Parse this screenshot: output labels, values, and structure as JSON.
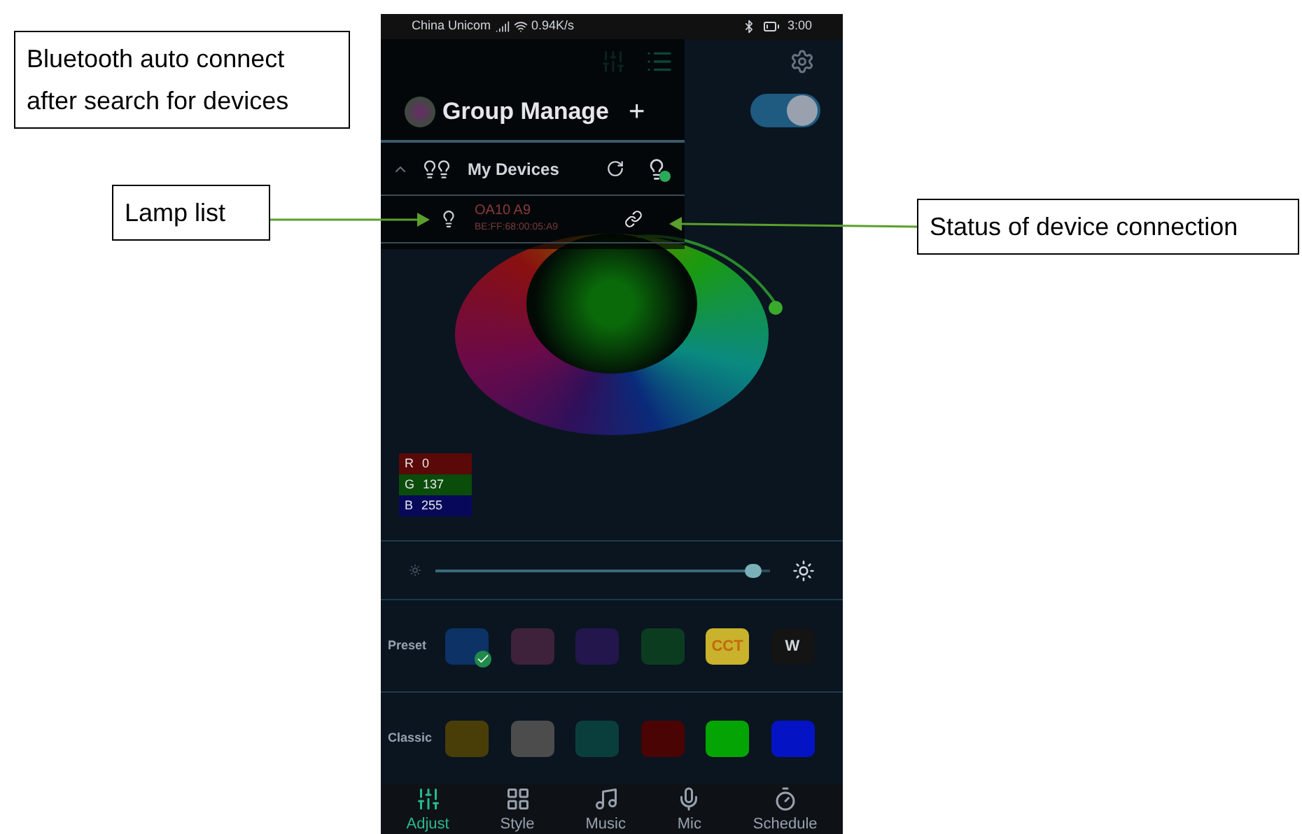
{
  "callouts": [
    {
      "text": "Bluetooth auto connect after search for devices"
    },
    {
      "text": "Lamp list"
    },
    {
      "text": "Status of device connection"
    }
  ],
  "status_bar": {
    "carrier": "China Unicom",
    "speed": "0.94K/s",
    "time": "3:00"
  },
  "power_toggle": {
    "on": true
  },
  "drawer": {
    "title": "Group Manage",
    "add": "+",
    "group": {
      "name": "My Devices",
      "expanded": true,
      "devices": [
        {
          "name": "OA10 A9",
          "address": "BE:FF:68:00:05:A9",
          "connected": true
        }
      ]
    }
  },
  "rgb": [
    {
      "channel": "R",
      "value": "0",
      "color": "#5a0808"
    },
    {
      "channel": "G",
      "value": "137",
      "color": "#0a4c0a"
    },
    {
      "channel": "B",
      "value": "255",
      "color": "#08085a"
    }
  ],
  "brightness": {
    "level": 0.95
  },
  "preset": {
    "label": "Preset",
    "swatches": [
      {
        "color": "#0c3266",
        "selected": true
      },
      {
        "color": "#3e223c",
        "selected": false
      },
      {
        "color": "#23164c",
        "selected": false
      },
      {
        "color": "#0c3c20",
        "selected": false
      },
      {
        "color": "#c9b22c",
        "label": "CCT",
        "selected": false
      },
      {
        "color": "#141414",
        "label": "W",
        "selected": false
      }
    ]
  },
  "classic": {
    "label": "Classic",
    "swatches": [
      {
        "color": "#4a3e08"
      },
      {
        "color": "#4c4c4c"
      },
      {
        "color": "#0a3e3c"
      },
      {
        "color": "#4a0404"
      },
      {
        "color": "#04a404"
      },
      {
        "color": "#0414c4"
      }
    ]
  },
  "tabs": [
    {
      "label": "Adjust",
      "selected": true
    },
    {
      "label": "Style",
      "selected": false
    },
    {
      "label": "Music",
      "selected": false
    },
    {
      "label": "Mic",
      "selected": false
    },
    {
      "label": "Schedule",
      "selected": false
    }
  ]
}
